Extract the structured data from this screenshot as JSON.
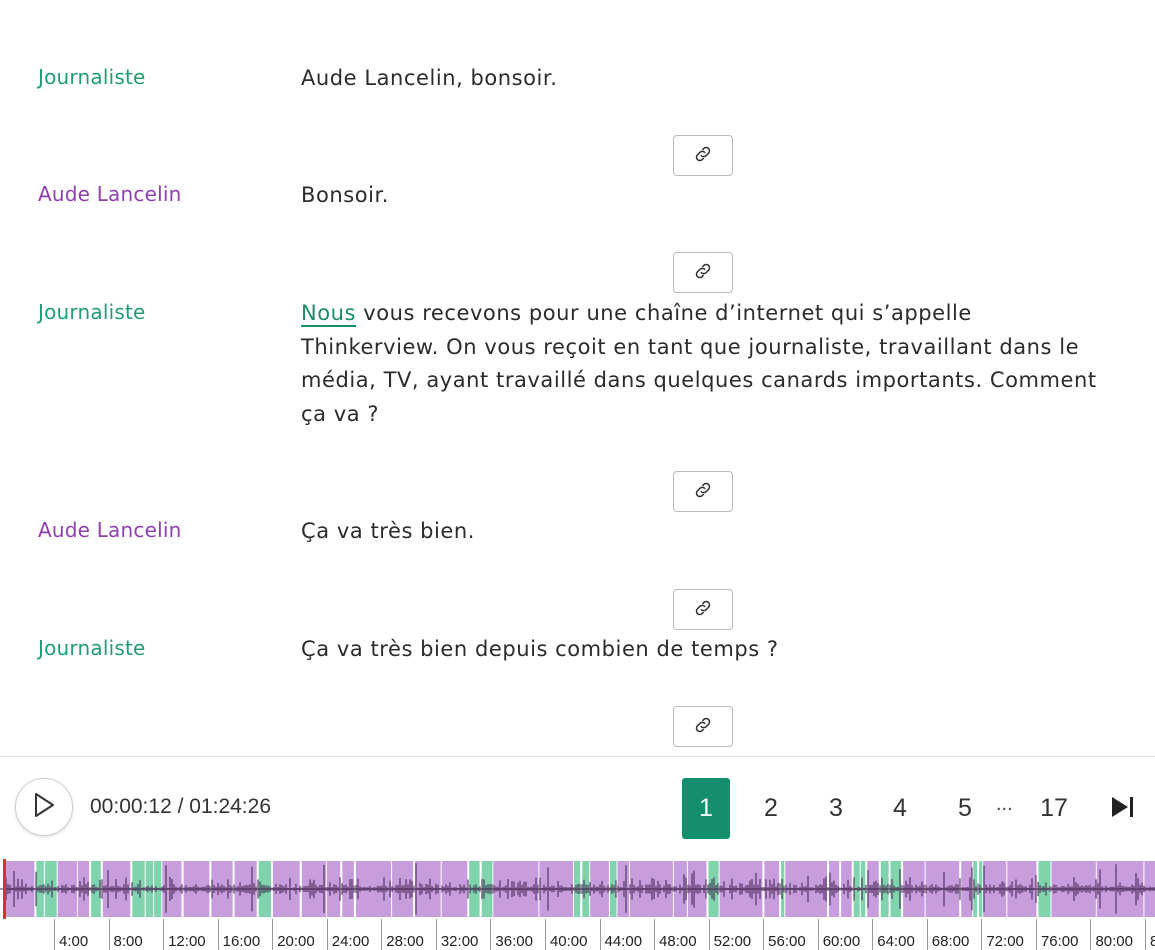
{
  "transcript": [
    {
      "speaker": "Journaliste",
      "speaker_type": "journalist",
      "text": "Aude Lancelin, bonsoir."
    },
    {
      "speaker": "Aude Lancelin",
      "speaker_type": "guest",
      "text": "Bonsoir."
    },
    {
      "speaker": "Journaliste",
      "speaker_type": "journalist",
      "highlight": "Nous",
      "text": " vous recevons pour une chaîne d’internet qui s’appelle Thinkerview. On vous reçoit en tant que journaliste, travaillant dans le média, TV, ayant travaillé dans quelques canards importants. Comment ça va ?"
    },
    {
      "speaker": "Aude Lancelin",
      "speaker_type": "guest",
      "text": "Ça va très bien."
    },
    {
      "speaker": "Journaliste",
      "speaker_type": "journalist",
      "text": "Ça va très bien depuis combien de temps ?"
    }
  ],
  "link_button_icon": "link-icon",
  "player": {
    "current_time": "00:00:12",
    "duration": "01:24:26",
    "time_display": "00:00:12 / 01:24:26",
    "play_icon": "play-icon",
    "last_page_icon": "skip-to-end-icon",
    "pages": [
      "1",
      "2",
      "3",
      "4",
      "5"
    ],
    "ellipsis": "...",
    "last_page": "17",
    "active_page": "1",
    "progress_fraction": 0.0024
  },
  "timeline_ticks": [
    "4:00",
    "8:00",
    "12:00",
    "16:00",
    "20:00",
    "24:00",
    "28:00",
    "32:00",
    "36:00",
    "40:00",
    "44:00",
    "48:00",
    "52:00",
    "56:00",
    "60:00",
    "64:00",
    "68:00",
    "72:00",
    "76:00",
    "80:00",
    "8"
  ],
  "colors": {
    "journalist": "#1e9e6e",
    "guest": "#8e3fb0",
    "accent": "#148f6e",
    "guest_segment": "#c79ddd",
    "journalist_segment": "#7fd3ad",
    "playhead": "#d9322b"
  }
}
